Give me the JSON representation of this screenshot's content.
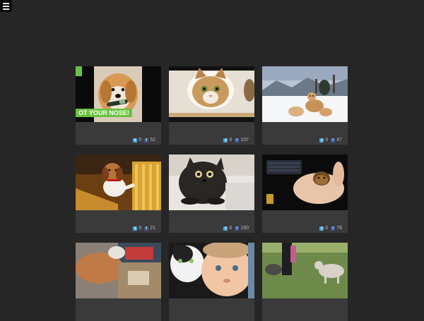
{
  "menu": {
    "icon": "hamburger-menu-icon"
  },
  "cards": [
    {
      "thumb_caption": "OT YOUR NOSE!",
      "twitter_count": "0",
      "facebook_count": "52"
    },
    {
      "twitter_count": "0",
      "facebook_count": "107"
    },
    {
      "twitter_count": "0",
      "facebook_count": "47"
    },
    {
      "twitter_count": "0",
      "facebook_count": "21"
    },
    {
      "twitter_count": "0",
      "facebook_count": "160"
    },
    {
      "twitter_count": "0",
      "facebook_count": "76"
    },
    {},
    {},
    {}
  ],
  "icons": {
    "twitter": "t",
    "facebook": "f"
  },
  "colors": {
    "background": "#262626",
    "card": "#3a3a3a",
    "twitter": "#4ea6d9",
    "facebook": "#3b5998",
    "caption_green": "#69c23f"
  }
}
